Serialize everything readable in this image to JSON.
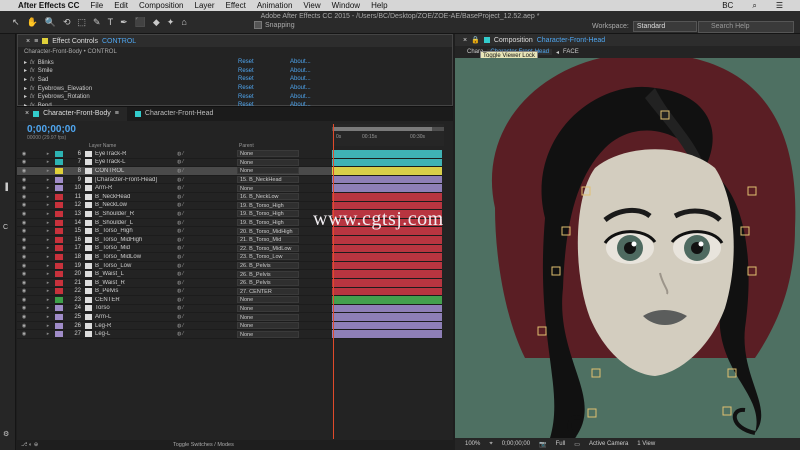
{
  "menubar": {
    "apple": "",
    "app": "After Effects CC",
    "items": [
      "File",
      "Edit",
      "Composition",
      "Layer",
      "Effect",
      "Animation",
      "View",
      "Window",
      "Help"
    ],
    "right_user": "BC",
    "right_search": "⌕",
    "right_menu": "☰"
  },
  "toolbar": {
    "window_title": "Adobe After Effects CC 2015 - /Users/BC/Desktop/ZOE/ZOE-AE/BaseProject_12.52.aep *",
    "snapping": "Snapping",
    "workspace_label": "Workspace:",
    "workspace_value": "Standard",
    "search_help": "Search Help",
    "tools": [
      "↖",
      "✋",
      "🔍",
      "⟲",
      "⬚",
      "✎",
      "T",
      "✒",
      "⬛",
      "◆",
      "✦",
      "⌂"
    ]
  },
  "effect_controls": {
    "title": "Effect Controls",
    "layer": "CONTROL",
    "breadcrumb": "Character-Front-Body • CONTROL",
    "reset": "Reset",
    "about": "About...",
    "effects": [
      "Blinks",
      "Smile",
      "Sad",
      "Eyebrows_Elevation",
      "Eyebrows_Rotation",
      "Bend"
    ]
  },
  "timeline": {
    "tab_active": "Character-Front-Body",
    "tab_other": "Character-Front-Head",
    "timecode": "0;00;00;00",
    "fps": "00000 (29.97 fps)",
    "col_layer": "Layer Name",
    "col_parent": "Parent",
    "ruler_labels": [
      "0s",
      "00:15s",
      "00:30s"
    ],
    "footer": "Toggle Switches / Modes",
    "layers": [
      {
        "num": "6",
        "name": "EyeTrack-R",
        "parent": "None",
        "label": "#2db3b3",
        "bar": "#3fb2b5"
      },
      {
        "num": "7",
        "name": "EyeTrack-L",
        "parent": "None",
        "label": "#2db3b3",
        "bar": "#3fb2b5"
      },
      {
        "num": "8",
        "name": "CONTROL",
        "parent": "None",
        "label": "#e0d13a",
        "bar": "#d8cf4a",
        "sel": true
      },
      {
        "num": "9",
        "name": "[Character-Front-Head]",
        "parent": "15. B_NeckHead",
        "label": "#a08cc8",
        "bar": "#8e7fb7"
      },
      {
        "num": "10",
        "name": "Arm-R",
        "parent": "None",
        "label": "#a08cc8",
        "bar": "#8e7fb7"
      },
      {
        "num": "11",
        "name": "B_NeckHead",
        "parent": "16. B_NeckLow",
        "label": "#c8323c",
        "bar": "#b83540"
      },
      {
        "num": "12",
        "name": "B_NeckLow",
        "parent": "19. B_Torso_High",
        "label": "#c8323c",
        "bar": "#b83540"
      },
      {
        "num": "13",
        "name": "B_Shoulder_R",
        "parent": "19. B_Torso_High",
        "label": "#c8323c",
        "bar": "#b83540"
      },
      {
        "num": "14",
        "name": "B_Shoulder_L",
        "parent": "19. B_Torso_High",
        "label": "#c8323c",
        "bar": "#b83540"
      },
      {
        "num": "15",
        "name": "B_Torso_High",
        "parent": "20. B_Torso_MidHigh",
        "label": "#c8323c",
        "bar": "#b83540"
      },
      {
        "num": "16",
        "name": "B_Torso_MidHigh",
        "parent": "21. B_Torso_Mid",
        "label": "#c8323c",
        "bar": "#b83540"
      },
      {
        "num": "17",
        "name": "B_Torso_Mid",
        "parent": "22. B_Torso_MidLow",
        "label": "#c8323c",
        "bar": "#b83540"
      },
      {
        "num": "18",
        "name": "B_Torso_MidLow",
        "parent": "23. B_Torso_Low",
        "label": "#c8323c",
        "bar": "#b83540"
      },
      {
        "num": "19",
        "name": "B_Torso_Low",
        "parent": "26. B_Pelvis",
        "label": "#c8323c",
        "bar": "#b83540"
      },
      {
        "num": "20",
        "name": "B_Waist_L",
        "parent": "26. B_Pelvis",
        "label": "#c8323c",
        "bar": "#b83540"
      },
      {
        "num": "21",
        "name": "B_Waist_R",
        "parent": "26. B_Pelvis",
        "label": "#c8323c",
        "bar": "#b83540"
      },
      {
        "num": "22",
        "name": "B_Pelvis",
        "parent": "27. CENTER",
        "label": "#c8323c",
        "bar": "#b83540"
      },
      {
        "num": "23",
        "name": "CENTER",
        "parent": "None",
        "label": "#3ea04a",
        "bar": "#43a04d"
      },
      {
        "num": "24",
        "name": "Torso",
        "parent": "None",
        "label": "#a08cc8",
        "bar": "#8e7fb7"
      },
      {
        "num": "25",
        "name": "Arm-L",
        "parent": "None",
        "label": "#a08cc8",
        "bar": "#8e7fb7"
      },
      {
        "num": "26",
        "name": "Leg-R",
        "parent": "None",
        "label": "#a08cc8",
        "bar": "#8e7fb7"
      },
      {
        "num": "27",
        "name": "Leg-L",
        "parent": "None",
        "label": "#a08cc8",
        "bar": "#8e7fb7"
      }
    ]
  },
  "composition": {
    "title": "Composition",
    "comp_name": "Character-Front-Head",
    "sub_prefix": "Chara",
    "sub_crumb": "Character-Front-Head",
    "sub_next": "FACE",
    "tooltip": "Toggle Viewer Lock",
    "footer": [
      "100%",
      "⌖",
      "0;00;00;00",
      "📷",
      "Full",
      "▭",
      "Active Camera",
      "1 View"
    ]
  },
  "watermark": "www.cgtsj.com"
}
